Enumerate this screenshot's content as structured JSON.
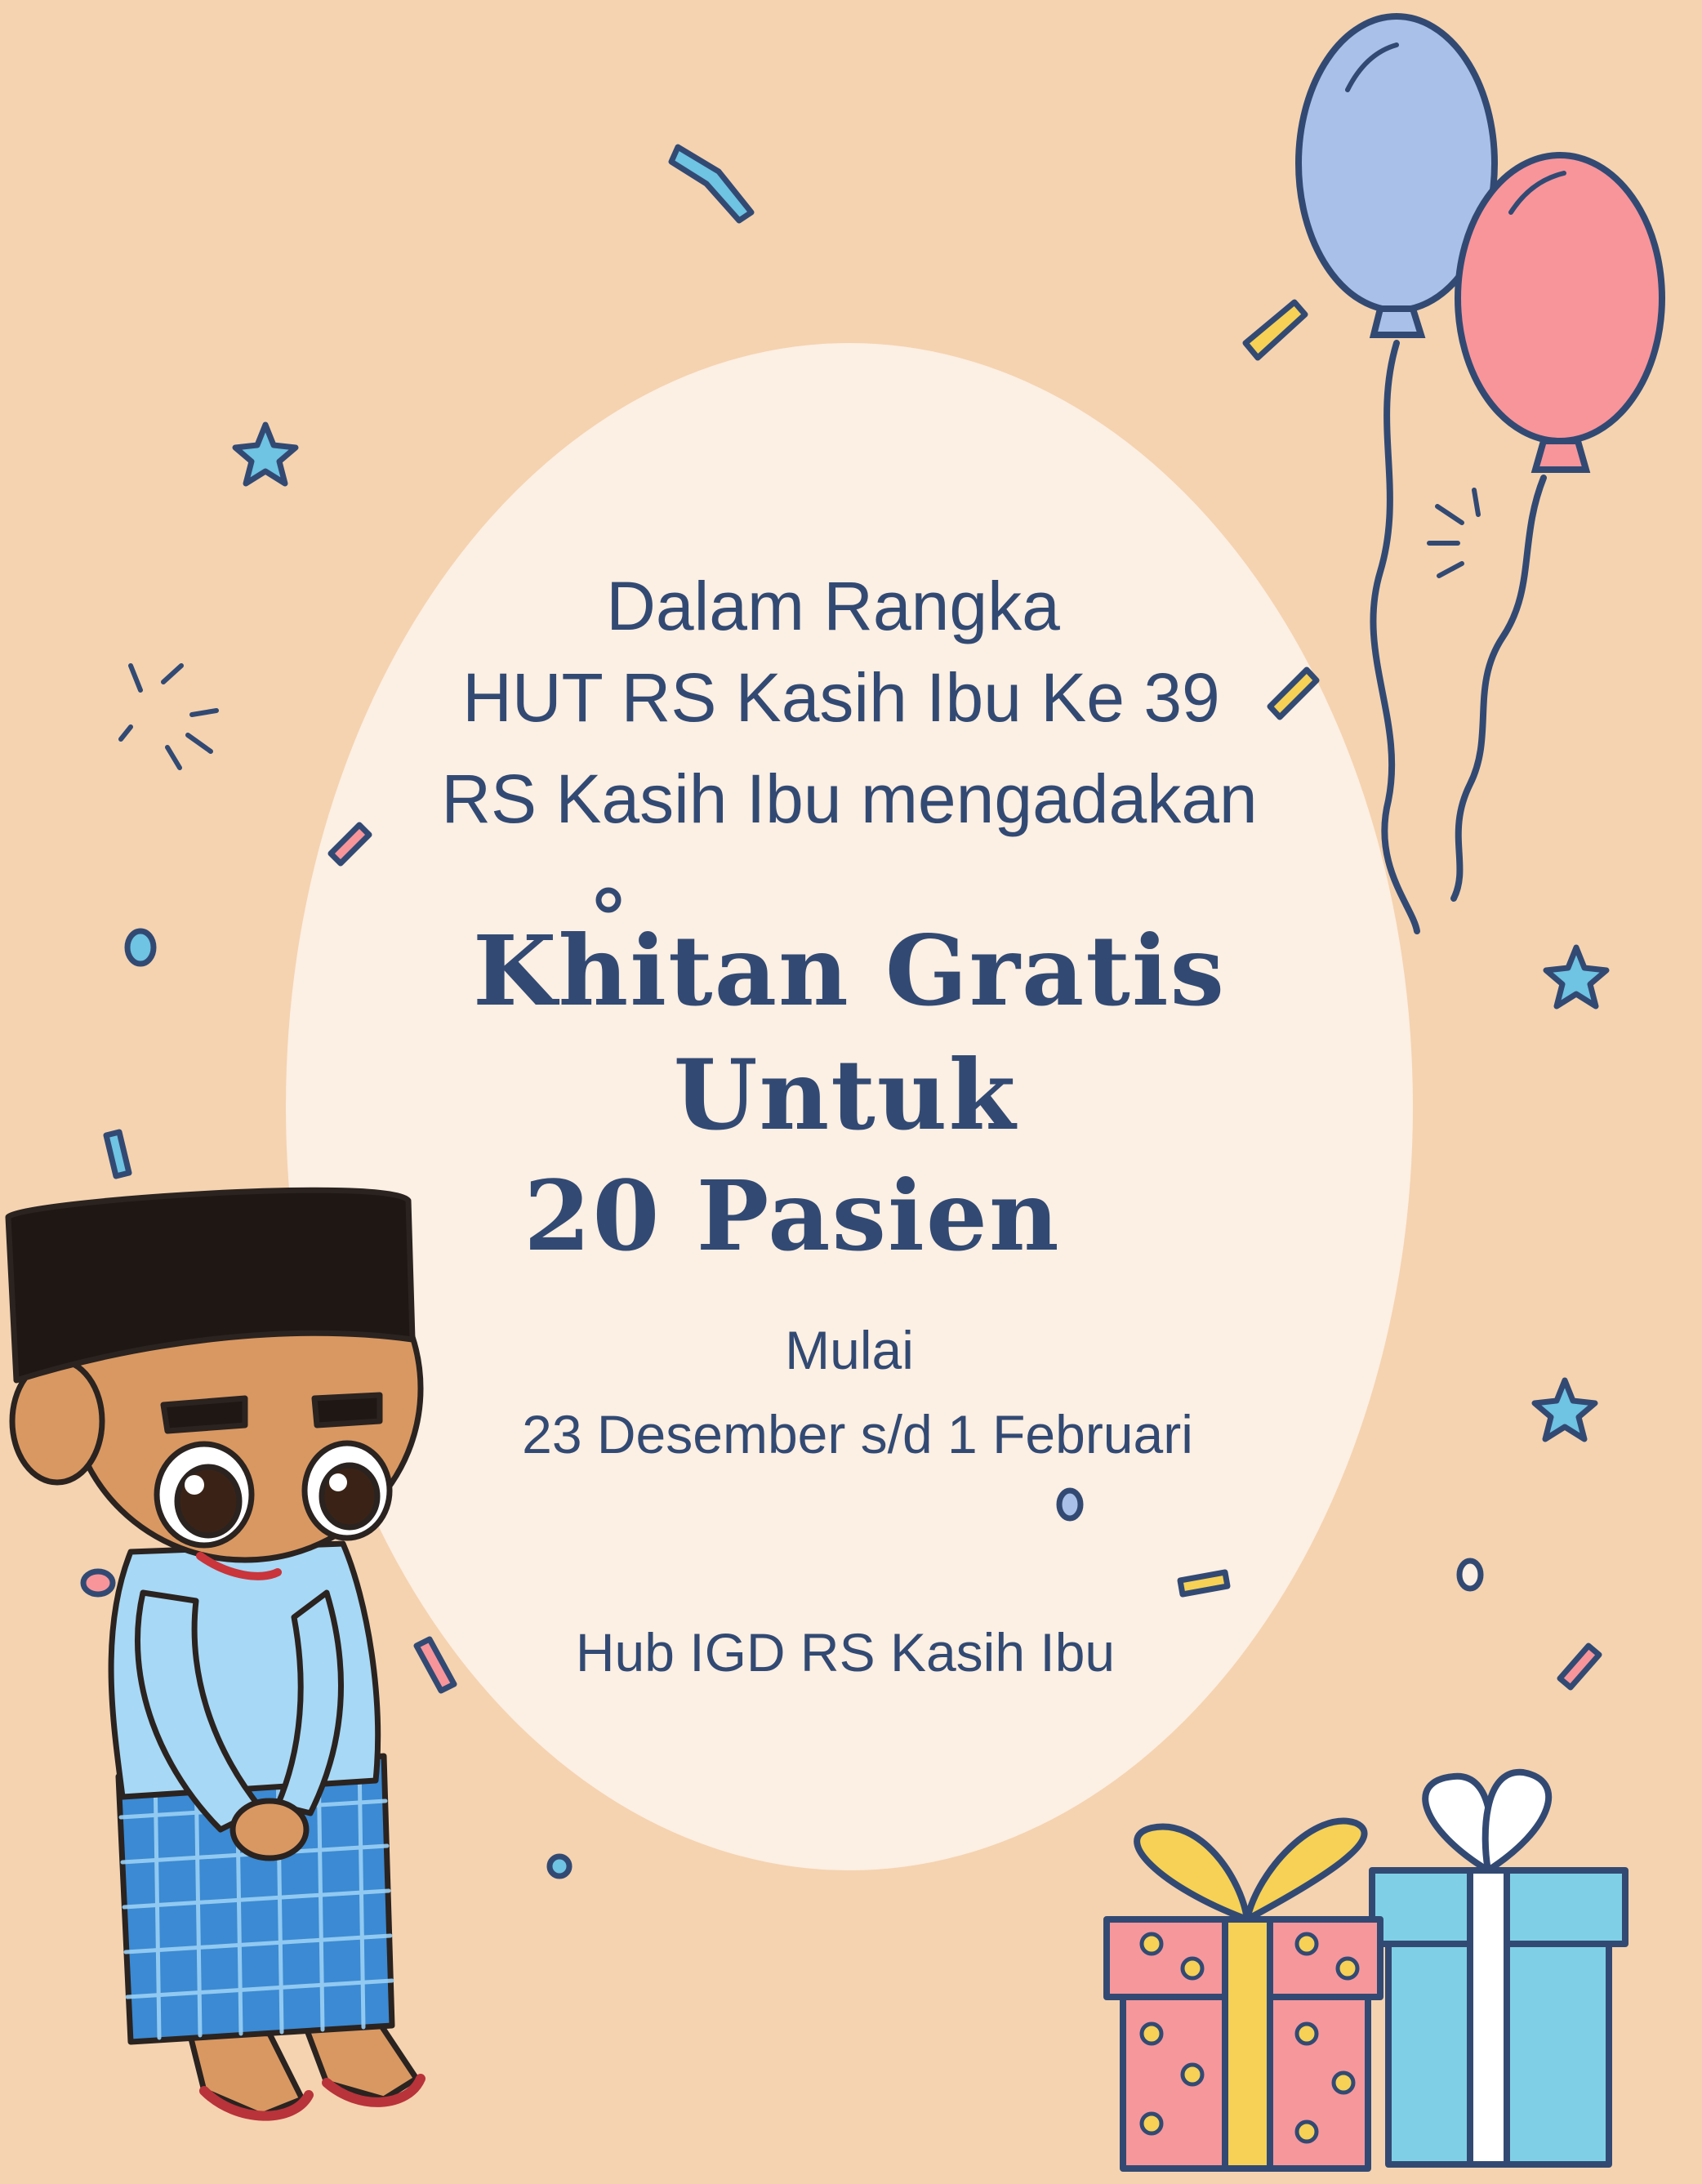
{
  "intro": {
    "line1": "Dalam Rangka",
    "line2": "HUT RS Kasih Ibu Ke 39",
    "line3": "RS Kasih Ibu mengadakan"
  },
  "headline": {
    "line1": "Khitan Gratis",
    "line2": "Untuk",
    "line3": "20 Pasien"
  },
  "schedule": {
    "label": "Mulai",
    "dates": "23 Desember s/d 1 Februari"
  },
  "contact": "Hub IGD RS Kasih Ibu",
  "colors": {
    "background": "#f5d3b0",
    "oval": "#fcefe3",
    "text": "#324a73",
    "balloon_blue": "#a9c1e8",
    "balloon_pink": "#f7959b",
    "gift_pink": "#f6979c",
    "gift_blue": "#7fd0e6",
    "ribbon_yellow": "#f6d156"
  }
}
